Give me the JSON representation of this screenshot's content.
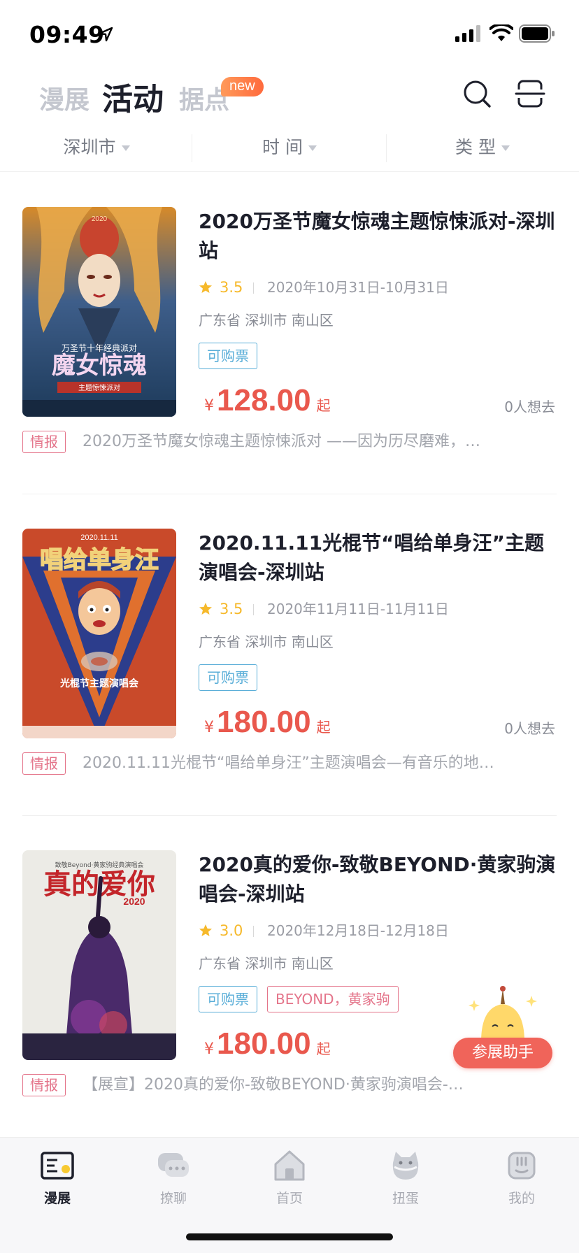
{
  "status_bar": {
    "time": "09:49"
  },
  "top_tabs": {
    "manzhan": "漫展",
    "huodong": "活动",
    "judian": "据点",
    "new_badge": "new"
  },
  "filters": {
    "city": "深圳市",
    "time": "时 间",
    "type": "类 型"
  },
  "events": [
    {
      "title": "2020万圣节魔女惊魂主题惊悚派对-深圳站",
      "rating": "3.5",
      "date": "2020年10月31日-10月31日",
      "location": "广东省 深圳市 南山区",
      "tags": [
        "可购票"
      ],
      "price_symbol": "¥",
      "price": "128.00",
      "price_suffix": "起",
      "want": "0人想去",
      "news_tag": "情报",
      "news_text": "2020万圣节魔女惊魂主题惊悚派对 ——因为历尽磨难，…"
    },
    {
      "title": "2020.11.11光棍节“唱给单身汪”主题演唱会-深圳站",
      "rating": "3.5",
      "date": "2020年11月11日-11月11日",
      "location": "广东省 深圳市 南山区",
      "tags": [
        "可购票"
      ],
      "price_symbol": "¥",
      "price": "180.00",
      "price_suffix": "起",
      "want": "0人想去",
      "news_tag": "情报",
      "news_text": "2020.11.11光棍节“唱给单身汪”主题演唱会—有音乐的地…"
    },
    {
      "title": "2020真的爱你-致敬BEYOND·黄家驹演唱会-深圳站",
      "rating": "3.0",
      "date": "2020年12月18日-12月18日",
      "location": "广东省 深圳市 南山区",
      "tags": [
        "可购票",
        "BEYOND，黄家驹"
      ],
      "price_symbol": "¥",
      "price": "180.00",
      "price_suffix": "起",
      "want": "",
      "news_tag": "情报",
      "news_text": "【展宣】2020真的爱你-致敬BEYOND·黄家驹演唱会-…"
    }
  ],
  "posters": [
    {
      "top_text": "2020",
      "mid_text": "万圣节十年经典派对",
      "main_text": "魔女惊魂",
      "sub_text": "主题惊悚派对"
    },
    {
      "top_text": "2020.11.11",
      "main_text": "唱给单身汪",
      "sub_text": "光棍节主题演唱会"
    },
    {
      "main_text": "真的爱你",
      "year_text": "2020",
      "sub_text": "致敬Beyond·黄家驹经典演唱会"
    }
  ],
  "helper": {
    "label": "参展助手"
  },
  "bottom_nav": [
    {
      "label": "漫展",
      "icon": "exhibition-icon",
      "active": true
    },
    {
      "label": "撩聊",
      "icon": "chat-icon",
      "active": false
    },
    {
      "label": "首页",
      "icon": "home-icon",
      "active": false
    },
    {
      "label": "扭蛋",
      "icon": "capsule-cat-icon",
      "active": false
    },
    {
      "label": "我的",
      "icon": "profile-icon",
      "active": false
    }
  ],
  "colors": {
    "accent_red": "#e9584d",
    "ticket_blue": "#5aaed8",
    "tag_pink": "#e4748a",
    "star_yellow": "#f6b92b",
    "tab_highlight": "#ffd43b"
  }
}
